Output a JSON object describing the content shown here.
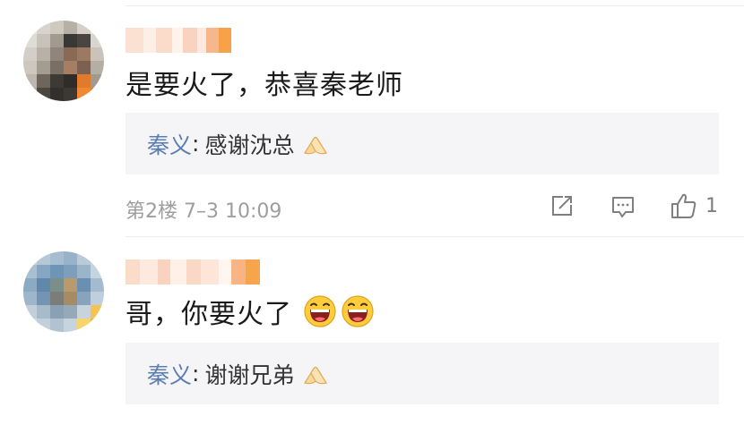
{
  "comments": [
    {
      "text": "是要火了，恭喜秦老师",
      "reply": {
        "author": "秦义",
        "colon": ":",
        "text": "感谢沈总",
        "emoji": "folded-hands-icon"
      },
      "meta": "第2楼 7–3 10:09",
      "like_count": "1",
      "actions": [
        "share-icon",
        "comment-icon",
        "thumbs-up-icon"
      ]
    },
    {
      "text": "哥，你要火了",
      "text_emojis": [
        "laughing-face-icon",
        "laughing-face-icon"
      ],
      "reply": {
        "author": "秦义",
        "colon": ":",
        "text": "谢谢兄弟",
        "emoji": "folded-hands-icon"
      }
    }
  ],
  "colors": {
    "reply_author": "#5b7eb1",
    "reply_bg": "#f5f5f7",
    "meta_text": "#9e9e9e",
    "body_text": "#1a1a1a"
  }
}
